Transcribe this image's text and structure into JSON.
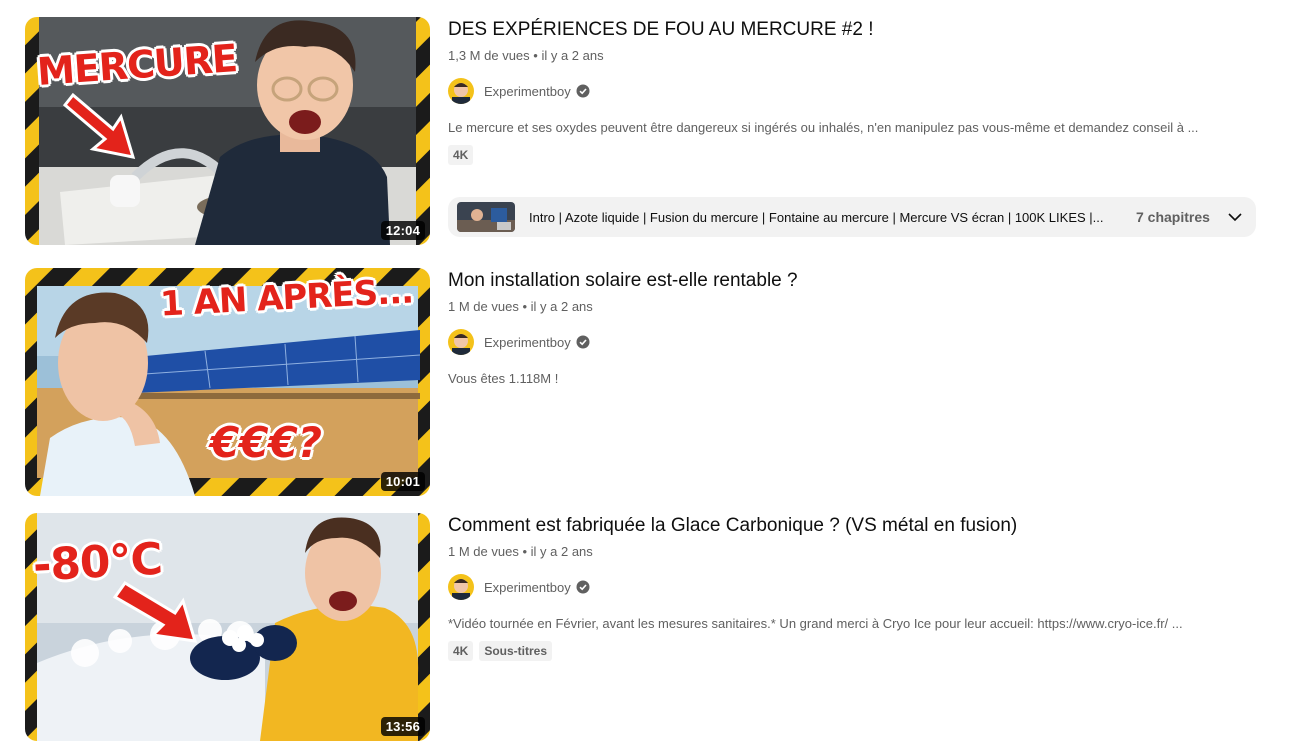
{
  "videos": [
    {
      "title": "DES EXPÉRIENCES DE FOU AU MERCURE #2 !",
      "views": "1,3 M de vues",
      "age": "il y a 2 ans",
      "channel": "Experimentboy",
      "description": "Le mercure et ses oxydes peuvent être dangereux si ingérés ou inhalés, n'en manipulez pas vous-même et demandez conseil à ...",
      "badges": [
        "4K"
      ],
      "duration": "12:04",
      "thumb_text": "MERCURE",
      "chapters": {
        "text": "Intro | Azote liquide | Fusion du mercure | Fontaine au mercure | Mercure VS écran | 100K LIKES |...",
        "count": "7 chapitres"
      }
    },
    {
      "title": "Mon installation solaire est-elle rentable ?",
      "views": "1 M de vues",
      "age": "il y a 2 ans",
      "channel": "Experimentboy",
      "description": "Vous êtes 1.118M !",
      "badges": [],
      "duration": "10:01",
      "thumb_text": "1 AN APRÈS...",
      "thumb_text2": "€€€?"
    },
    {
      "title": "Comment est fabriquée la Glace Carbonique ? (VS métal en fusion)",
      "views": "1 M de vues",
      "age": "il y a 2 ans",
      "channel": "Experimentboy",
      "description": "*Vidéo tournée en Février, avant les mesures sanitaires.* Un grand merci à Cryo Ice pour leur accueil: https://www.cryo-ice.fr/ ...",
      "badges": [
        "4K",
        "Sous-titres"
      ],
      "duration": "13:56",
      "thumb_text": "-80°C"
    }
  ],
  "separator": "•",
  "colors": {
    "meta": "#606060",
    "badge_bg": "#f2f2f2",
    "hazard_yellow": "#f4c21a",
    "thumb_red": "#e3231b"
  }
}
